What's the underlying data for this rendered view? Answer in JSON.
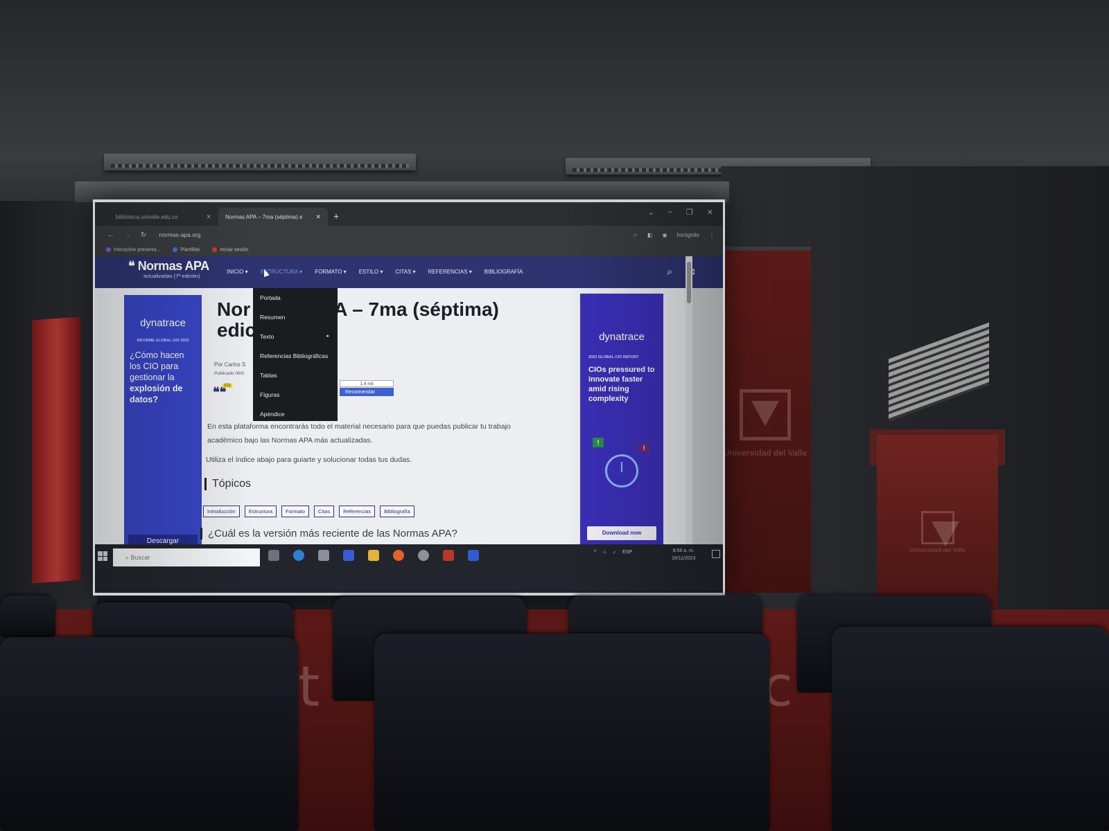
{
  "browser": {
    "tabs": [
      {
        "title": "biblioteca.univalle.edu.co",
        "active": false
      },
      {
        "title": "Normas APA – 7ma (séptima) e",
        "active": true
      }
    ],
    "new_tab": "+",
    "window_controls": [
      "⌄",
      "–",
      "❐",
      "✕"
    ],
    "url": "normas-apa.org",
    "profile_label": "Incógnito",
    "bookmarks": [
      "Interactive presenta...",
      "Plantillas",
      "Iniciar sesión"
    ]
  },
  "site": {
    "logo_title": "Normas APA",
    "logo_subtitle": "actualizadas (7ª edición)",
    "menu": [
      "INICIO",
      "ESTRUCTURA",
      "FORMATO",
      "ESTILO",
      "CITAS",
      "REFERENCIAS",
      "BIBLIOGRAFÍA"
    ],
    "active_menu_index": 1,
    "dropdown": [
      "Portada",
      "Resumen",
      "Texto",
      "Referencias Bibliográficas",
      "Tablas",
      "Figuras",
      "Apéndice"
    ],
    "title_line1": "Nor",
    "title_line1_right": "A – 7ma (séptima)",
    "title_line2": "edic",
    "byline": "Por Carlos S",
    "published": "Publicado 06/0",
    "share_count_badge": "151",
    "fb_count": "1,4 mil",
    "fb_recommend": "Recomendar",
    "intro_1": "En esta plataforma encontrarás todo el material necesario para que puedas publicar tu trabajo",
    "intro_2": "académico bajo las Normas APA más actualizadas.",
    "intro_3": "Utiliza el índice abajo para guiarte y solucionar todas tus dudas.",
    "topics_title": "Tópicos",
    "tags": [
      "Introducción",
      "Estructura",
      "Formato",
      "Citas",
      "Referencias",
      "Bibliografía"
    ],
    "question": "¿Cuál es la versión más reciente de las Normas APA?"
  },
  "ad_left": {
    "brand": "dynatrace",
    "kicker": "INFORME GLOBAL CIO 2022",
    "question_1": "¿Cómo hacen los CIO para gestionar la",
    "question_bold": "explosión de datos?",
    "button": "Descargar"
  },
  "ad_right": {
    "brand": "dynatrace",
    "kicker": "2023 GLOBAL CIO REPORT",
    "headline": "CIOs pressured to innovate faster amid rising complexity",
    "button": "Download now"
  },
  "taskbar": {
    "search_placeholder": "Buscar",
    "language": "ESP",
    "time": "8:56 a. m.",
    "date": "16/11/2023"
  },
  "room": {
    "banner_text": "Universidad del Valle"
  },
  "colors": {
    "site_nav": "#2d3470",
    "ad_left_bg": "#3845c4",
    "ad_right_bg": "#3b2fb8",
    "banner_red": "#5a1a17"
  }
}
